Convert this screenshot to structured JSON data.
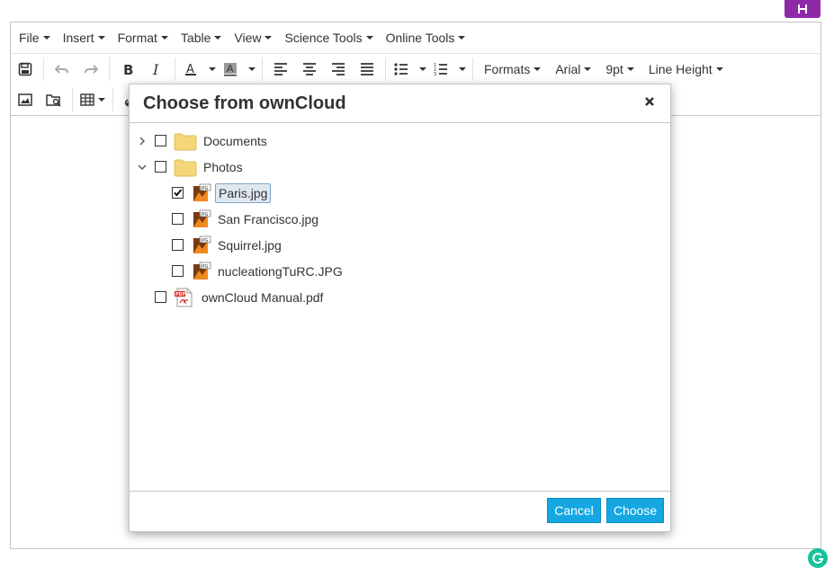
{
  "menubar": [
    "File",
    "Insert",
    "Format",
    "Table",
    "View",
    "Science Tools",
    "Online Tools"
  ],
  "toolbar": {
    "formats_label": "Formats",
    "font_label": "Arial",
    "size_label": "9pt",
    "line_height_label": "Line Height"
  },
  "dialog": {
    "title": "Choose from ownCloud",
    "tree": [
      {
        "label": "Documents",
        "type": "folder",
        "expanded": false,
        "checked": false
      },
      {
        "label": "Photos",
        "type": "folder",
        "expanded": true,
        "checked": false
      },
      {
        "label": "Paris.jpg",
        "type": "image",
        "checked": true,
        "selected": true
      },
      {
        "label": "San Francisco.jpg",
        "type": "image",
        "checked": false
      },
      {
        "label": "Squirrel.jpg",
        "type": "image",
        "checked": false
      },
      {
        "label": "nucleationgTuRC.JPG",
        "type": "image",
        "checked": false
      },
      {
        "label": "ownCloud Manual.pdf",
        "type": "pdf",
        "checked": false
      }
    ],
    "cancel_label": "Cancel",
    "choose_label": "Choose"
  },
  "colors": {
    "accent": "#14a7e2",
    "corner_button": "#8e2aa8",
    "folder": "#f5d77a",
    "grammarly": "#15c39a"
  }
}
